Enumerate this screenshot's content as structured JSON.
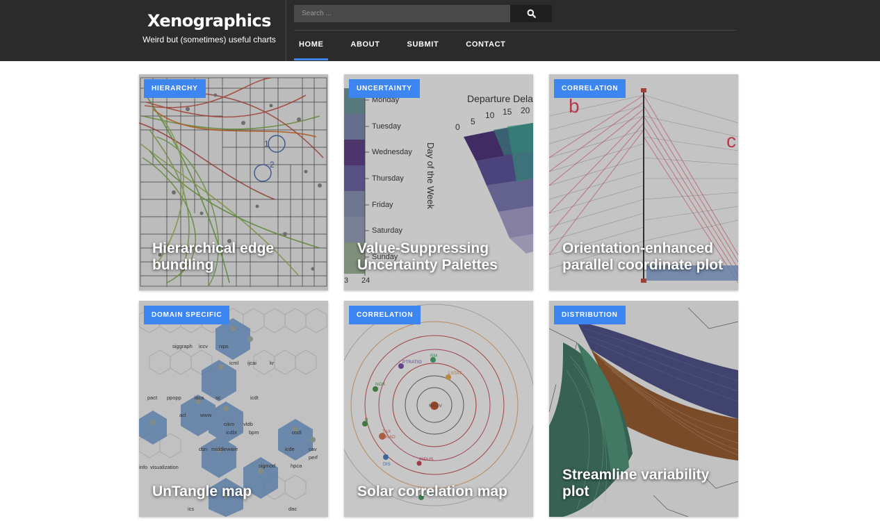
{
  "site": {
    "title": "Xenographics",
    "tagline": "Weird but (sometimes) useful charts"
  },
  "search": {
    "placeholder": "Search ...",
    "button_icon": "search-icon"
  },
  "nav": {
    "items": [
      {
        "label": "HOME",
        "active": true
      },
      {
        "label": "ABOUT",
        "active": false
      },
      {
        "label": "SUBMIT",
        "active": false
      },
      {
        "label": "CONTACT",
        "active": false
      }
    ]
  },
  "colors": {
    "header_bg": "#2b2b2b",
    "accent": "#3d86f2",
    "badge_bg": "#3d86f2"
  },
  "cards": [
    {
      "category": "HIERARCHY",
      "title": "Hierarchical edge bundling",
      "thumb_text": [
        "1",
        "2"
      ]
    },
    {
      "category": "UNCERTAINTY",
      "title": "Value-Suppressing Uncertainty Palettes",
      "thumb_text": [
        "Monday",
        "Tuesday",
        "Wednesday",
        "Thursday",
        "Friday",
        "Saturday",
        "Sunday",
        "Day of the Week",
        "Departure Dela",
        "0",
        "5",
        "10",
        "15",
        "20",
        "3",
        "24"
      ]
    },
    {
      "category": "CORRELATION",
      "title": "Orientation-enhanced parallel coordinate plot",
      "thumb_text": [
        "b",
        "c"
      ]
    },
    {
      "category": "DOMAIN SPECIFIC",
      "title": "UnTangle map",
      "thumb_text": [
        "siggraph",
        "iccv",
        "nips",
        "icml",
        "ijcai",
        "kr",
        "pact",
        "ppopp",
        "isca",
        "sc",
        "icdt",
        "acl",
        "www",
        "cikm",
        "vldb",
        "icdbt",
        "bpm",
        "dsn",
        "middleware",
        "info",
        "visualization",
        "icde",
        "sigmod",
        "hpca",
        "ics",
        "dac",
        "cav",
        "perf",
        "osdi"
      ]
    },
    {
      "category": "CORRELATION",
      "title": "Solar correlation map",
      "thumb_text": [
        "MEDV",
        "PTRATIO",
        "RM",
        "LSTAT",
        "NOX",
        "TAX",
        "RAD",
        "DIS",
        "INDUS",
        "CHAS",
        "B"
      ]
    },
    {
      "category": "DISTRIBUTION",
      "title": "Streamline variability plot",
      "thumb_text": []
    }
  ]
}
